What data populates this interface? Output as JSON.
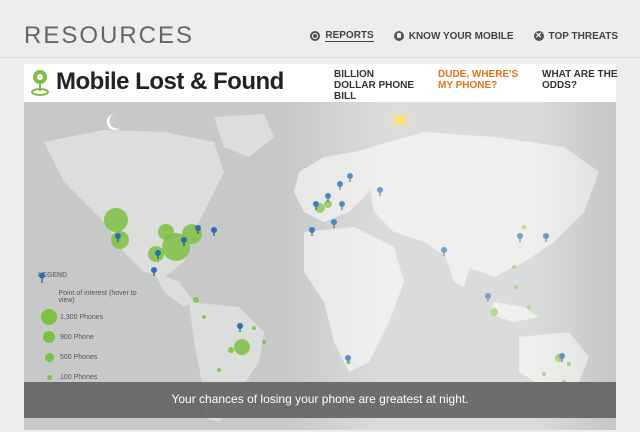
{
  "header": {
    "section_title": "RESOURCES",
    "nav": [
      {
        "label": "REPORTS",
        "icon": "radio-icon",
        "active": true
      },
      {
        "label": "KNOW YOUR MOBILE",
        "icon": "phone-icon",
        "active": false
      },
      {
        "label": "TOP THREATS",
        "icon": "x-icon",
        "active": false
      }
    ]
  },
  "page": {
    "title": "Mobile Lost & Found",
    "tabs": [
      {
        "label": "BILLION DOLLAR PHONE BILL",
        "active": false
      },
      {
        "label": "DUDE, WHERE'S MY PHONE?",
        "active": true
      },
      {
        "label": "WHAT ARE THE ODDS?",
        "active": false
      }
    ]
  },
  "legend": {
    "title": "LEGEND",
    "items": [
      {
        "label": "Point of interest (hover to view)",
        "kind": "pin"
      },
      {
        "label": "1,300 Phones",
        "kind": "circle"
      },
      {
        "label": "900 Phone",
        "kind": "circle"
      },
      {
        "label": "500 Phones",
        "kind": "circle"
      },
      {
        "label": "100 Phones",
        "kind": "circle"
      }
    ]
  },
  "map": {
    "caption": "Your chances of losing your phone are greatest at night.",
    "night_icon": "moon-icon",
    "day_icon": "sun-icon"
  },
  "colors": {
    "accent": "#e8731e",
    "circle": "#7cc142",
    "pin": "#2a6fb3",
    "land": "#e3e4e2",
    "ocean": "#c7c9c9"
  }
}
